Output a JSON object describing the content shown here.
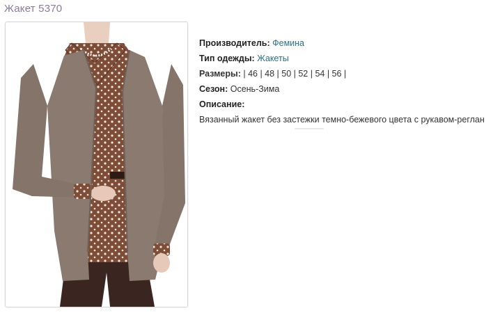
{
  "product": {
    "title": "Жакет 5370",
    "image_alt": "product-photo"
  },
  "details": {
    "manufacturer_label": "Производитель:",
    "manufacturer_value": "Фемина",
    "clothing_type_label": "Тип одежды:",
    "clothing_type_value": "Жакеты",
    "sizes_label": "Размеры:",
    "sizes_text": "| 46 | 48 | 50 | 52 | 54 | 56 |",
    "season_label": "Сезон:",
    "season_value": "Осень-Зима",
    "description_label": "Описание:",
    "description_text": "Вязанный жакет без застежки темно-бежевого цвета с рукавом-реглан"
  },
  "colors": {
    "title": "#8a7aa0",
    "link": "#2a6f86",
    "jacket": "#8b7a70",
    "blouse": "#7a4a36",
    "pants": "#3a2520"
  }
}
